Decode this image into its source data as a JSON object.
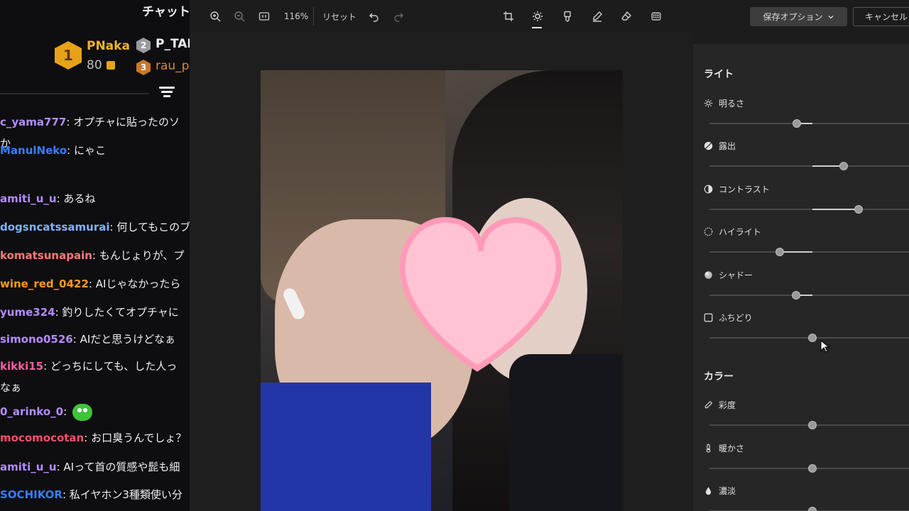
{
  "chat": {
    "title": "チャット",
    "leaderboard": [
      {
        "rank": "1",
        "name": "PNaka",
        "score": "80"
      },
      {
        "rank": "2",
        "name": "P_TAI"
      },
      {
        "rank": "3",
        "name": "rau_p"
      }
    ],
    "messages": [
      {
        "user": "c_yama777",
        "color": "#b48cff",
        "text": ": オプチャに貼ったのソ",
        "cont": "か"
      },
      {
        "user": "ManulNeko",
        "color": "#3a7dff",
        "text": ": にゃこ"
      },
      {
        "user": "amiti_u_u",
        "color": "#b48cff",
        "text": ": あるね"
      },
      {
        "user": "dogsncatssamurai",
        "color": "#7fb3ff",
        "text": ": 何してもこのブ"
      },
      {
        "user": "komatsunapain",
        "color": "#ff7a7a",
        "text": ": もんじょりが、プ"
      },
      {
        "user": "wine_red_0422",
        "color": "#ff9a1f",
        "text": ": AIじゃなかったら"
      },
      {
        "user": "yume324",
        "color": "#b48cff",
        "text": ": 釣りしたくてオプチャに"
      },
      {
        "user": "simono0526",
        "color": "#b48cff",
        "text": ": AIだと思うけどなぁ"
      },
      {
        "user": "kikki15",
        "color": "#ff5fa2",
        "text": ": どっちにしても、した人っ",
        "cont": "なぁ"
      },
      {
        "user": "0_arinko_0",
        "color": "#b48cff",
        "text": ":",
        "emote": "green-blob-emote"
      },
      {
        "user": "mocomocotan",
        "color": "#ff4d6d",
        "text": ": お口臭うんでしょ？"
      },
      {
        "user": "amiti_u_u",
        "color": "#b48cff",
        "text": ": AIって首の質感や髭も細"
      },
      {
        "user": "SOCHIKOR",
        "color": "#3a7dff",
        "text": ": 私イヤホン3種類使い分"
      }
    ]
  },
  "toolbar": {
    "zoom": "116%",
    "reset_label": "リセット",
    "save_options_label": "保存オプション",
    "cancel_label": "キャンセル"
  },
  "panel": {
    "light_title": "ライト",
    "color_title": "カラー",
    "adjustments": [
      {
        "key": "brightness",
        "label": "明るさ",
        "icon": "sun-icon",
        "value": -15
      },
      {
        "key": "exposure",
        "label": "露出",
        "icon": "exposure-icon",
        "value": 30
      },
      {
        "key": "contrast",
        "label": "コントラスト",
        "icon": "contrast-icon",
        "value": 45
      },
      {
        "key": "highlights",
        "label": "ハイライト",
        "icon": "highlights-icon",
        "value": -32
      },
      {
        "key": "shadows",
        "label": "シャドー",
        "icon": "shadows-icon",
        "value": -16
      },
      {
        "key": "vignette",
        "label": "ふちどり",
        "icon": "vignette-icon",
        "value": 0
      },
      {
        "key": "saturation",
        "label": "彩度",
        "icon": "eyedropper-icon",
        "value": 0
      },
      {
        "key": "warmth",
        "label": "暖かさ",
        "icon": "thermometer-icon",
        "value": 0
      },
      {
        "key": "tint",
        "label": "濃淡",
        "icon": "droplet-icon",
        "value": 0
      }
    ]
  },
  "colors": {
    "background": "#1c1c1c",
    "panel": "#262626",
    "chat_bg": "#0e0e10",
    "gold": "#f0b429",
    "heart": "#ffc3d4"
  }
}
